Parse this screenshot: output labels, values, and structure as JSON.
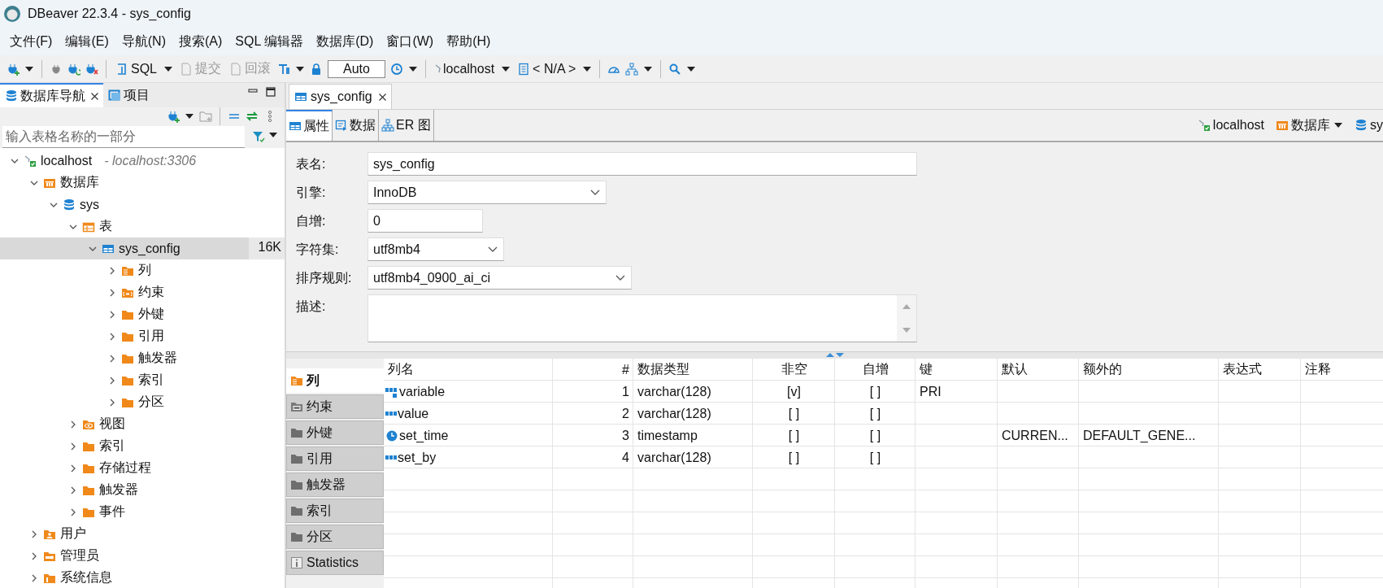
{
  "window": {
    "title": "DBeaver 22.3.4 - sys_config"
  },
  "menu": [
    "文件(F)",
    "编辑(E)",
    "导航(N)",
    "搜索(A)",
    "SQL 编辑器",
    "数据库(D)",
    "窗口(W)",
    "帮助(H)"
  ],
  "toolbar": {
    "sql": "SQL",
    "commit": {
      "label": "提交",
      "disabled": true
    },
    "rollback": {
      "label": "回滚",
      "disabled": true
    },
    "mode": "Auto",
    "datasource": "localhost",
    "schema": "< N/A >"
  },
  "navigator": {
    "tabs": [
      {
        "label": "数据库导航",
        "selected": true,
        "closable": true
      },
      {
        "label": "项目",
        "selected": false,
        "closable": false
      }
    ],
    "filter": {
      "placeholder": "输入表格名称的一部分"
    },
    "tree": [
      {
        "label": "localhost",
        "detail": "- localhost:3306",
        "kind": "connection",
        "expanded": true,
        "selected": false,
        "children": [
          {
            "label": "数据库",
            "kind": "database-folder",
            "expanded": true,
            "selected": false,
            "children": [
              {
                "label": "sys",
                "kind": "schema",
                "expanded": true,
                "selected": false,
                "children": [
                  {
                    "label": "表",
                    "kind": "table-folder",
                    "expanded": true,
                    "selected": false,
                    "children": [
                      {
                        "label": "sys_config",
                        "size": "16K",
                        "kind": "table",
                        "expanded": true,
                        "selected": true,
                        "children": [
                          {
                            "label": "列",
                            "kind": "columns-folder",
                            "expanded": false,
                            "selected": false
                          },
                          {
                            "label": "约束",
                            "kind": "constraints-folder",
                            "expanded": false,
                            "selected": false
                          },
                          {
                            "label": "外键",
                            "kind": "folder",
                            "expanded": false,
                            "selected": false
                          },
                          {
                            "label": "引用",
                            "kind": "folder",
                            "expanded": false,
                            "selected": false
                          },
                          {
                            "label": "触发器",
                            "kind": "folder",
                            "expanded": false,
                            "selected": false
                          },
                          {
                            "label": "索引",
                            "kind": "folder",
                            "expanded": false,
                            "selected": false
                          },
                          {
                            "label": "分区",
                            "kind": "folder",
                            "expanded": false,
                            "selected": false
                          }
                        ]
                      }
                    ]
                  },
                  {
                    "label": "视图",
                    "kind": "views-folder",
                    "expanded": false,
                    "selected": false
                  },
                  {
                    "label": "索引",
                    "kind": "folder",
                    "expanded": false,
                    "selected": false
                  },
                  {
                    "label": "存储过程",
                    "kind": "folder",
                    "expanded": false,
                    "selected": false
                  },
                  {
                    "label": "触发器",
                    "kind": "folder",
                    "expanded": false,
                    "selected": false
                  },
                  {
                    "label": "事件",
                    "kind": "folder",
                    "expanded": false,
                    "selected": false
                  }
                ]
              }
            ]
          },
          {
            "label": "用户",
            "kind": "users-folder",
            "expanded": false,
            "selected": false
          },
          {
            "label": "管理员",
            "kind": "admin-folder",
            "expanded": false,
            "selected": false
          },
          {
            "label": "系统信息",
            "kind": "info-folder",
            "expanded": false,
            "selected": false
          }
        ]
      }
    ]
  },
  "editor": {
    "tabs": [
      {
        "label": "sys_config",
        "selected": true
      }
    ],
    "subtabs": [
      {
        "label": "属性",
        "kind": "table",
        "selected": true
      },
      {
        "label": "数据",
        "kind": "data",
        "selected": false
      },
      {
        "label": "ER 图",
        "kind": "diagram",
        "selected": false
      }
    ],
    "breadcrumb": [
      {
        "label": "localhost",
        "kind": "connection",
        "dropdown": false
      },
      {
        "label": "数据库",
        "kind": "database-folder",
        "dropdown": true
      },
      {
        "label": "sy",
        "kind": "schema",
        "dropdown": false
      }
    ],
    "fields": [
      {
        "label": "表名:",
        "kind": "text",
        "value": "sys_config"
      },
      {
        "label": "引擎:",
        "kind": "select",
        "value": "InnoDB"
      },
      {
        "label": "自增:",
        "kind": "text",
        "value": "0"
      },
      {
        "label": "字符集:",
        "kind": "select",
        "value": "utf8mb4"
      },
      {
        "label": "排序规则:",
        "kind": "select",
        "value": "utf8mb4_0900_ai_ci"
      },
      {
        "label": "描述:",
        "kind": "textarea"
      }
    ],
    "sections": [
      {
        "label": "列",
        "kind": "columns",
        "selected": true
      },
      {
        "label": "约束",
        "kind": "constraints",
        "selected": false
      },
      {
        "label": "外键",
        "kind": "folder",
        "selected": false
      },
      {
        "label": "引用",
        "kind": "folder",
        "selected": false
      },
      {
        "label": "触发器",
        "kind": "folder",
        "selected": false
      },
      {
        "label": "索引",
        "kind": "folder",
        "selected": false
      },
      {
        "label": "分区",
        "kind": "folder",
        "selected": false
      },
      {
        "label": "Statistics",
        "kind": "info",
        "selected": false
      }
    ],
    "columns_table": {
      "headers": [
        "列名",
        "#",
        "数据类型",
        "非空",
        "自增",
        "键",
        "默认",
        "额外的",
        "表达式",
        "注释"
      ],
      "rows": [
        {
          "kind": "string-key",
          "name": "variable",
          "number": "1",
          "type": "varchar(128)",
          "not_null": "[v]",
          "auto_increment": "[ ]",
          "key": "PRI"
        },
        {
          "kind": "string",
          "name": "value",
          "number": "2",
          "type": "varchar(128)",
          "not_null": "[ ]",
          "auto_increment": "[ ]"
        },
        {
          "kind": "time",
          "name": "set_time",
          "number": "3",
          "type": "timestamp",
          "not_null": "[ ]",
          "auto_increment": "[ ]",
          "default": "CURREN...",
          "extra": "DEFAULT_GENE..."
        },
        {
          "kind": "string",
          "name": "set_by",
          "number": "4",
          "type": "varchar(128)",
          "not_null": "[ ]",
          "auto_increment": "[ ]"
        }
      ]
    }
  }
}
